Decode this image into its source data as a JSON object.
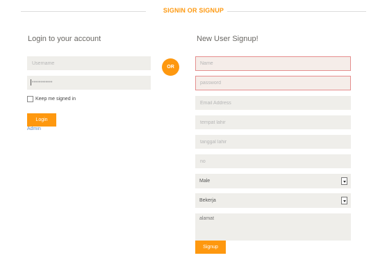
{
  "header": {
    "title": "SIGNIN OR SIGNUP"
  },
  "login": {
    "title": "Login to your account",
    "username_placeholder": "Username",
    "password_value": "••••••••••••",
    "keep_signed_in_label": "Keep me signed in",
    "login_button": "Login",
    "admin_link": "Admin"
  },
  "divider": {
    "or_label": "OR"
  },
  "signup": {
    "title": "New User Signup!",
    "name_placeholder": "Name",
    "password_placeholder": "password",
    "email_placeholder": "Email Address",
    "tempat_lahir_placeholder": "tempat lahir",
    "tanggal_lahir_placeholder": "tanggal lahir",
    "no_placeholder": "no",
    "gender_selected": "Male",
    "status_selected": "Bekerja",
    "alamat_placeholder": "alamat",
    "signup_button": "Signup"
  },
  "colors": {
    "accent": "#fe980f",
    "field_bg": "#efeeea",
    "error_border": "#e58e8e",
    "link": "#5b8cc8"
  }
}
